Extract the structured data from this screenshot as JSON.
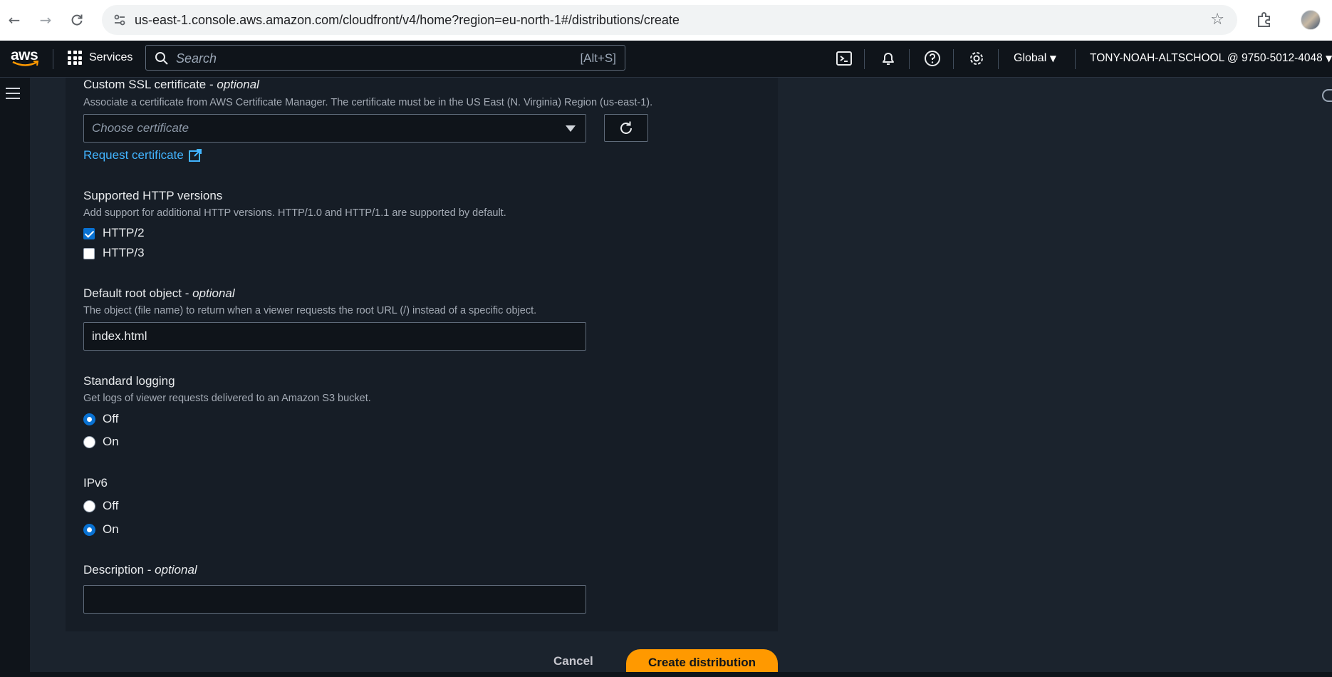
{
  "browser": {
    "url": "us-east-1.console.aws.amazon.com/cloudfront/v4/home?region=eu-north-1#/distributions/create"
  },
  "topnav": {
    "logo_text": "aws",
    "services_label": "Services",
    "search_placeholder": "Search",
    "search_shortcut": "[Alt+S]",
    "region_label": "Global",
    "account_label": "TONY-NOAH-ALTSCHOOL @ 9750-5012-4048"
  },
  "form": {
    "ssl": {
      "label": "Custom SSL certificate - ",
      "label_optional": "optional",
      "description": "Associate a certificate from AWS Certificate Manager. The certificate must be in the US East (N. Virginia) Region (us-east-1).",
      "select_placeholder": "Choose certificate",
      "request_link": "Request certificate"
    },
    "http_versions": {
      "label": "Supported HTTP versions",
      "description": "Add support for additional HTTP versions. HTTP/1.0 and HTTP/1.1 are supported by default.",
      "options": [
        {
          "label": "HTTP/2",
          "checked": true
        },
        {
          "label": "HTTP/3",
          "checked": false
        }
      ]
    },
    "root_object": {
      "label": "Default root object - ",
      "label_optional": "optional",
      "description": "The object (file name) to return when a viewer requests the root URL (/) instead of a specific object.",
      "value": "index.html"
    },
    "logging": {
      "label": "Standard logging",
      "description": "Get logs of viewer requests delivered to an Amazon S3 bucket.",
      "options": [
        {
          "label": "Off",
          "selected": true
        },
        {
          "label": "On",
          "selected": false
        }
      ]
    },
    "ipv6": {
      "label": "IPv6",
      "options": [
        {
          "label": "Off",
          "selected": false
        },
        {
          "label": "On",
          "selected": true
        }
      ]
    },
    "description_field": {
      "label": "Description - ",
      "label_optional": "optional",
      "value": ""
    }
  },
  "actions": {
    "cancel_label": "Cancel",
    "create_label": "Create distribution"
  },
  "colors": {
    "accent": "#0972d3",
    "link": "#42b4ff",
    "primary_button": "#ff9900"
  }
}
